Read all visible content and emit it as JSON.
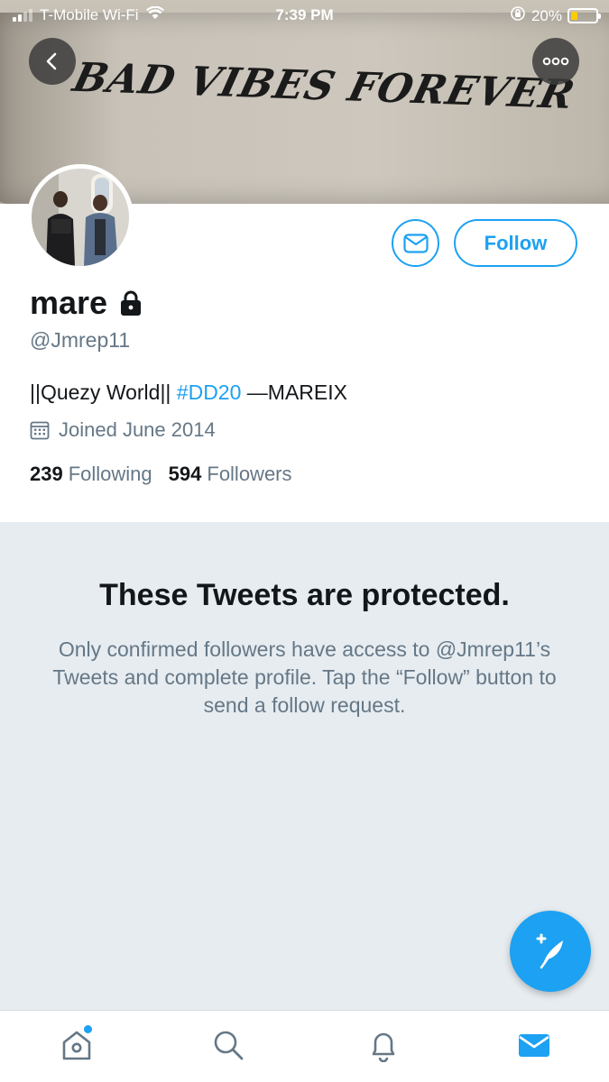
{
  "status_bar": {
    "carrier": "T-Mobile Wi-Fi",
    "time": "7:39 PM",
    "battery": "20%"
  },
  "header": {
    "banner_text": "BAD VIBES FOREVER"
  },
  "profile": {
    "name": "mare",
    "handle": "@Jmrep11",
    "bio_prefix": "||Quezy World|| ",
    "bio_hashtag": "#DD20",
    "bio_suffix": " —MAREIX",
    "joined": "Joined June 2014",
    "following_count": "239",
    "following_label": "Following",
    "followers_count": "594",
    "followers_label": "Followers",
    "follow_button": "Follow"
  },
  "protected": {
    "title": "These Tweets are protected.",
    "message": "Only confirmed followers have access to @Jmrep11’s Tweets and complete profile. Tap the “Follow” button to send a follow request."
  },
  "colors": {
    "accent": "#1da1f2",
    "secondary_text": "#657786",
    "protected_bg": "#e6ecf0"
  },
  "icons": [
    "back-icon",
    "more-icon",
    "lock-icon",
    "envelope-icon",
    "calendar-icon",
    "compose-icon",
    "home-icon",
    "search-icon",
    "bell-icon",
    "mail-icon"
  ]
}
